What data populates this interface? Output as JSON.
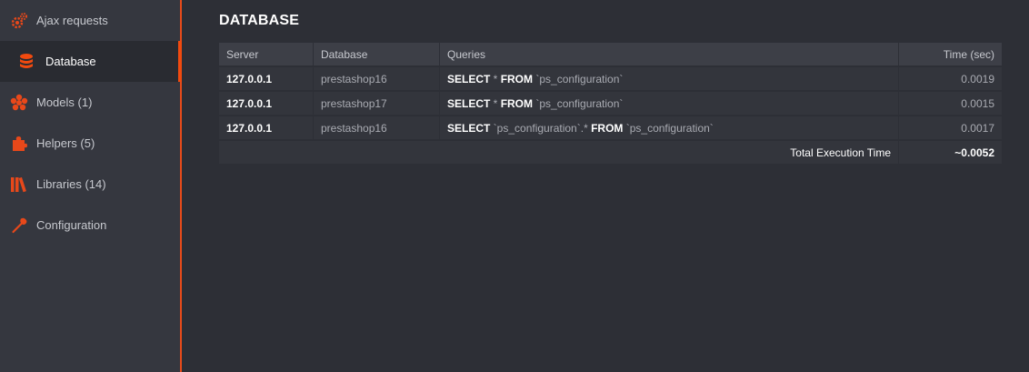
{
  "sidebar": {
    "accent_color": "#f14a0f",
    "items": [
      {
        "label": "Ajax requests",
        "icon": "gears-icon"
      },
      {
        "label": "Database",
        "icon": "database-icon",
        "active": true
      },
      {
        "label": "Models (1)",
        "icon": "asterisk-icon"
      },
      {
        "label": "Helpers (5)",
        "icon": "puzzle-icon"
      },
      {
        "label": "Libraries (14)",
        "icon": "books-icon"
      },
      {
        "label": "Configuration",
        "icon": "wrench-icon"
      }
    ]
  },
  "main": {
    "title": "DATABASE",
    "table": {
      "headers": {
        "server": "Server",
        "database": "Database",
        "queries": "Queries",
        "time": "Time (sec)"
      },
      "rows": [
        {
          "server": "127.0.0.1",
          "database": "prestashop16",
          "q": {
            "select": "SELECT",
            "cols": " * ",
            "from": "FROM",
            "table": " `ps_configuration`"
          },
          "time": "0.0019"
        },
        {
          "server": "127.0.0.1",
          "database": "prestashop17",
          "q": {
            "select": "SELECT",
            "cols": " * ",
            "from": "FROM",
            "table": " `ps_configuration`"
          },
          "time": "0.0015"
        },
        {
          "server": "127.0.0.1",
          "database": "prestashop16",
          "q": {
            "select": "SELECT",
            "cols": " `ps_configuration`.* ",
            "from": "FROM",
            "table": " `ps_configuration`"
          },
          "time": "0.0017"
        }
      ],
      "total_label": "Total Execution Time",
      "total_value": "~0.0052"
    }
  }
}
